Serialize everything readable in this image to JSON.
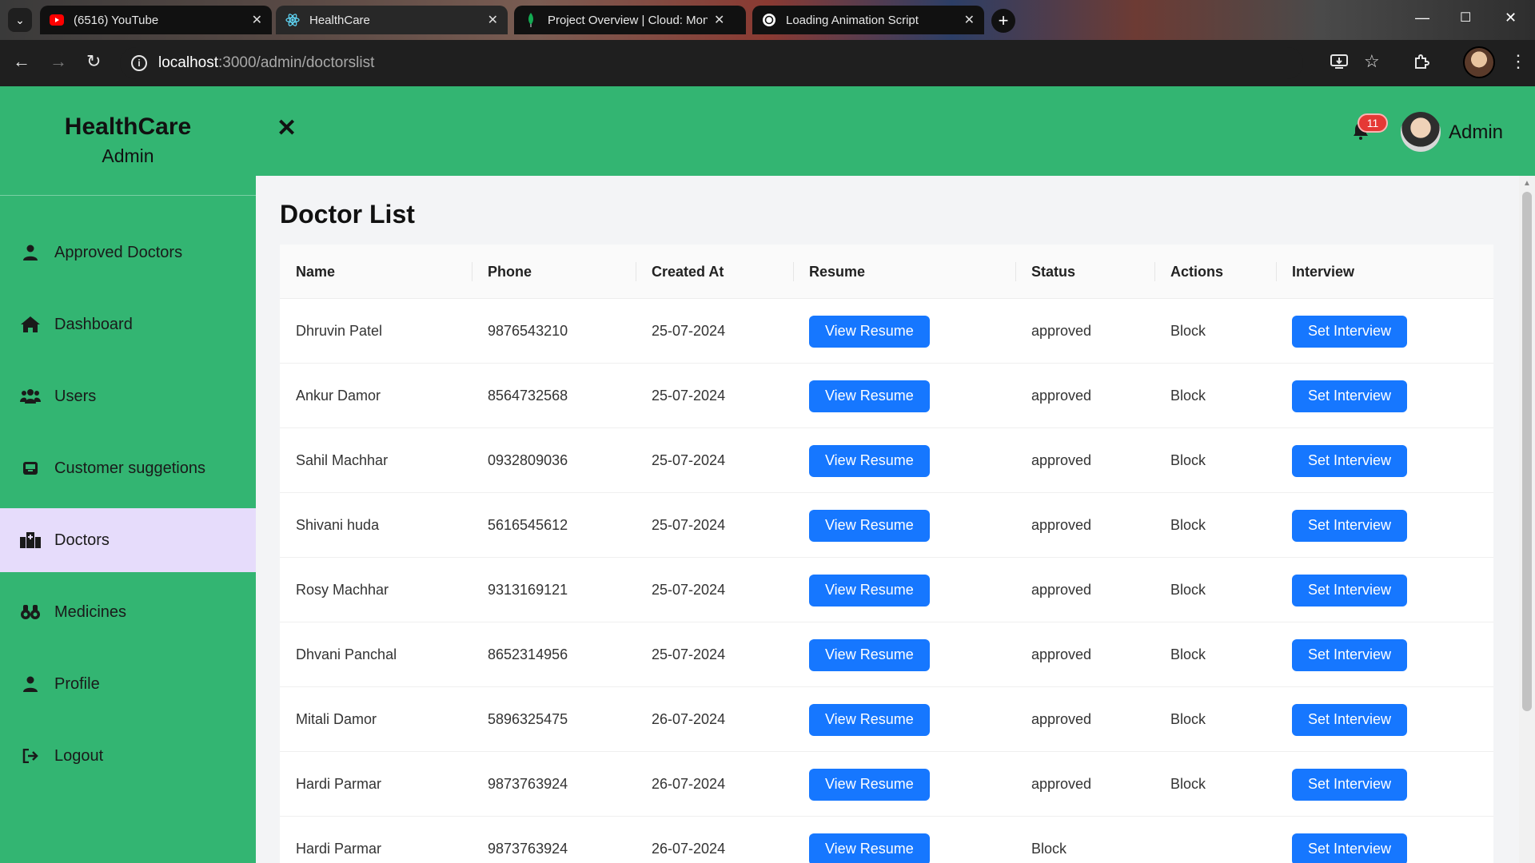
{
  "browser": {
    "tabs": [
      {
        "title": "(6516) YouTube",
        "icon": "youtube-icon",
        "active": false
      },
      {
        "title": "HealthCare",
        "icon": "react-icon",
        "active": true
      },
      {
        "title": "Project Overview | Cloud: MongoDB",
        "icon": "mongodb-leaf-icon",
        "active": false
      },
      {
        "title": "Loading Animation Script",
        "icon": "chatgpt-icon",
        "active": false
      }
    ],
    "url_host": "localhost",
    "url_path": ":3000/admin/doctorslist"
  },
  "sidebar": {
    "brand_name": "HealthCare",
    "brand_sub": "Admin",
    "items": [
      {
        "label": "Approved Doctors",
        "icon": "user-icon",
        "active": false
      },
      {
        "label": "Dashboard",
        "icon": "home-icon",
        "active": false
      },
      {
        "label": "Users",
        "icon": "users-icon",
        "active": false
      },
      {
        "label": "Customer suggetions",
        "icon": "inbox-icon",
        "active": false
      },
      {
        "label": "Doctors",
        "icon": "hospital-icon",
        "active": true
      },
      {
        "label": "Medicines",
        "icon": "binoculars-icon",
        "active": false
      },
      {
        "label": "Profile",
        "icon": "user-icon",
        "active": false
      },
      {
        "label": "Logout",
        "icon": "logout-icon",
        "active": false
      }
    ]
  },
  "header": {
    "notification_count": "11",
    "admin_name": "Admin"
  },
  "main": {
    "title": "Doctor List",
    "columns": [
      "Name",
      "Phone",
      "Created At",
      "Resume",
      "Status",
      "Actions",
      "Interview"
    ],
    "resume_button": "View Resume",
    "interview_button": "Set Interview",
    "rows": [
      {
        "name": "Dhruvin Patel",
        "phone": "9876543210",
        "created": "25-07-2024",
        "status": "approved",
        "action": "Block"
      },
      {
        "name": "Ankur Damor",
        "phone": "8564732568",
        "created": "25-07-2024",
        "status": "approved",
        "action": "Block"
      },
      {
        "name": "Sahil Machhar",
        "phone": "0932809036",
        "created": "25-07-2024",
        "status": "approved",
        "action": "Block"
      },
      {
        "name": "Shivani huda",
        "phone": "5616545612",
        "created": "25-07-2024",
        "status": "approved",
        "action": "Block"
      },
      {
        "name": "Rosy Machhar",
        "phone": "9313169121",
        "created": "25-07-2024",
        "status": "approved",
        "action": "Block"
      },
      {
        "name": "Dhvani Panchal",
        "phone": "8652314956",
        "created": "25-07-2024",
        "status": "approved",
        "action": "Block"
      },
      {
        "name": "Mitali Damor",
        "phone": "5896325475",
        "created": "26-07-2024",
        "status": "approved",
        "action": "Block"
      },
      {
        "name": "Hardi Parmar",
        "phone": "9873763924",
        "created": "26-07-2024",
        "status": "approved",
        "action": "Block"
      },
      {
        "name": "Hardi Parmar",
        "phone": "9873763924",
        "created": "26-07-2024",
        "status": "Block",
        "action": ""
      }
    ]
  },
  "colors": {
    "brand_green": "#33b572",
    "active_item": "#e6dcfb",
    "primary_button": "#1677ff",
    "badge_red": "#e53935"
  }
}
